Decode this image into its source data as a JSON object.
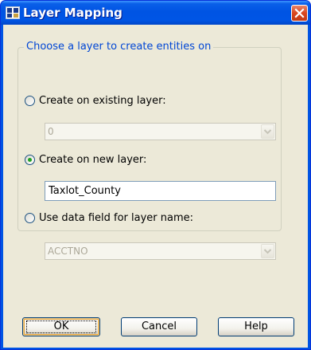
{
  "window": {
    "title": "Layer Mapping",
    "app_icon": "autocad-map-icon",
    "close_icon": "close-icon"
  },
  "group": {
    "legend": "Choose a layer to create entities on"
  },
  "options": [
    {
      "label": "Create on existing layer:",
      "selected": false
    },
    {
      "label": "Create on new layer:",
      "selected": true
    },
    {
      "label": "Use data field for layer name:",
      "selected": false
    }
  ],
  "existing_layer_combo": {
    "value": "0",
    "enabled": false
  },
  "new_layer_name": {
    "value": "Taxlot_County"
  },
  "data_field_combo": {
    "value": "ACCTNO",
    "enabled": false
  },
  "buttons": {
    "ok": "OK",
    "cancel": "Cancel",
    "help": "Help"
  },
  "colors": {
    "titlebar": "#0054e3",
    "dialog_bg": "#ece9d8",
    "legend_text": "#0046d5",
    "radio_dot": "#21a121",
    "close_button": "#d9461e"
  }
}
